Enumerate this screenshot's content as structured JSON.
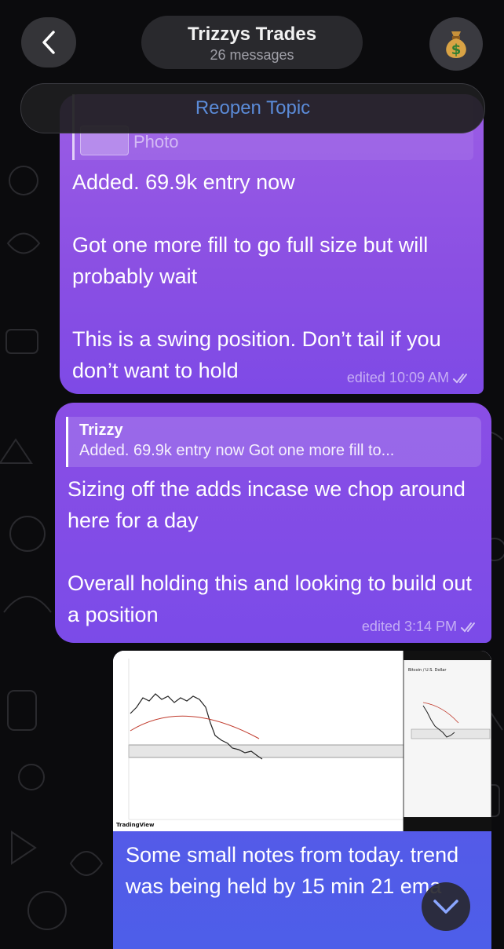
{
  "header": {
    "title": "Trizzys Trades",
    "subtitle": "26 messages",
    "back_icon": "chevron-left-icon",
    "avatar_icon": "money-bag-icon"
  },
  "topic_banner": {
    "label": "Reopen Topic"
  },
  "messages": [
    {
      "reply_media_label": "Photo",
      "text": "Added. 69.9k entry now\n\nGot one more fill to go full size but will probably wait\n\nThis is a swing position. Don’t tail if you don’t want to hold",
      "meta": "edited 10:09 AM"
    },
    {
      "reply_author": "Trizzy",
      "reply_preview": "Added. 69.9k entry now Got one more fill to...",
      "text": "Sizing off the adds incase we chop around here for a day\n\nOverall holding this and looking to build out a position",
      "meta": "edited 3:14 PM"
    },
    {
      "image_caption_brand": "TradingView",
      "mobile_chart_title": "Bitcoin / U.S. Dollar",
      "text": "Some small notes from today. trend was being held by 15 min 21 ema"
    }
  ],
  "scroll_button_icon": "chevron-down-icon",
  "colors": {
    "bubble_purple": "#8a4fe3",
    "bubble_blue": "#4d5ee9",
    "link_blue": "#5b8bd8",
    "background": "#0b0b0d"
  }
}
